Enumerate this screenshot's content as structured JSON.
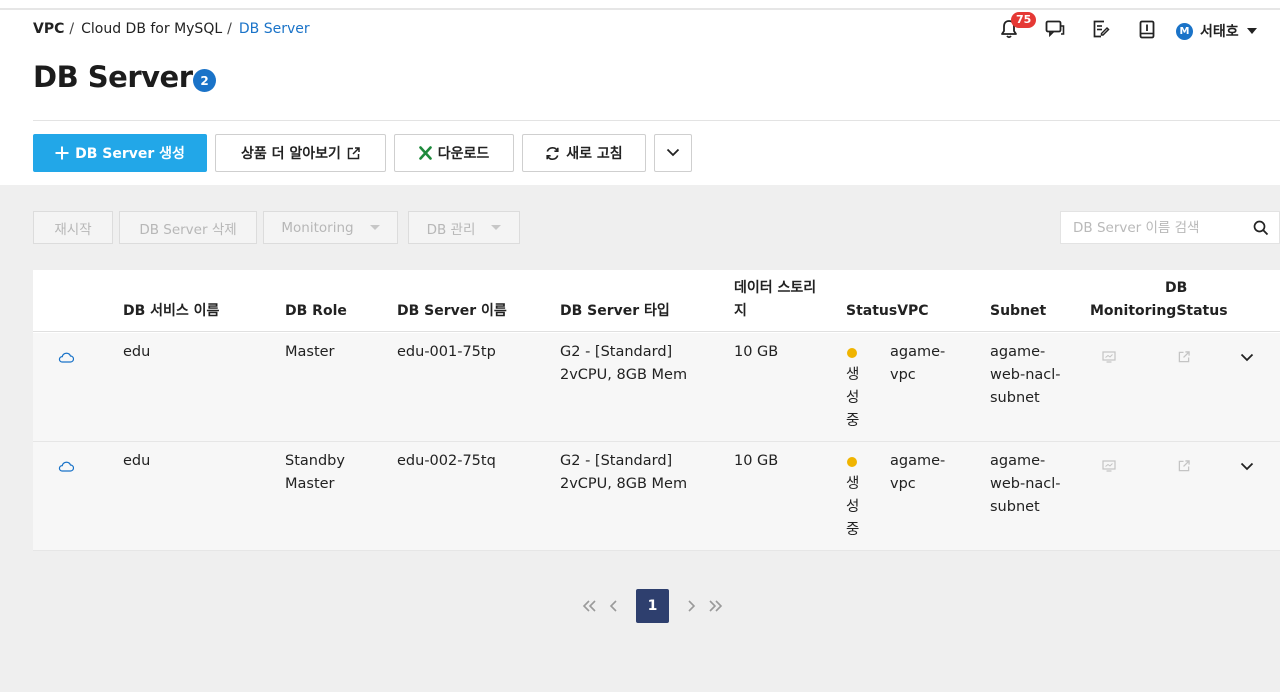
{
  "breadcrumb": {
    "items": [
      "VPC",
      "Cloud DB for MySQL",
      "DB Server"
    ],
    "separator": "/"
  },
  "header": {
    "notification_count": "75",
    "user_initial": "M",
    "user_name": "서태호"
  },
  "page": {
    "title": "DB Server",
    "count": "2"
  },
  "actions": {
    "create_label": "DB Server 생성",
    "learn_more_label": "상품 더 알아보기",
    "download_label": "다운로드",
    "refresh_label": "새로 고침"
  },
  "toolbar": {
    "restart_label": "재시작",
    "delete_label": "DB Server 삭제",
    "monitoring_label": "Monitoring",
    "db_manage_label": "DB 관리",
    "search_placeholder": "DB Server 이름 검색"
  },
  "table": {
    "columns": {
      "service_name": "DB 서비스 이름",
      "role": "DB Role",
      "server_name": "DB Server 이름",
      "server_type": "DB Server 타입",
      "storage_line1": "데이터 스토리",
      "storage_line2": "지",
      "status_vpc": "StatusVPC",
      "subnet": "Subnet",
      "db_line1": "DB",
      "monitoring_status": "MonitoringStatus"
    },
    "rows": [
      {
        "service_name": "edu",
        "role_line1": "Master",
        "role_line2": "",
        "server_name": "edu-001-75tp",
        "type_line1": "G2 - [Standard]",
        "type_line2": "2vCPU, 8GB Mem",
        "storage": "10 GB",
        "status": "생성중",
        "vpc_line1": "agame-",
        "vpc_line2": "vpc",
        "subnet_line1": "agame-",
        "subnet_line2": "web-nacl-",
        "subnet_line3": "subnet"
      },
      {
        "service_name": "edu",
        "role_line1": "Standby",
        "role_line2": "Master",
        "server_name": "edu-002-75tq",
        "type_line1": "G2 - [Standard]",
        "type_line2": "2vCPU, 8GB Mem",
        "storage": "10 GB",
        "status": "생성중",
        "vpc_line1": "agame-",
        "vpc_line2": "vpc",
        "subnet_line1": "agame-",
        "subnet_line2": "web-nacl-",
        "subnet_line3": "subnet"
      }
    ]
  },
  "pagination": {
    "current_page": "1"
  },
  "colors": {
    "primary": "#22a7e8",
    "link": "#1a73c8",
    "status_creating": "#f0b400",
    "page_active": "#2e3f6e",
    "badge_red": "#e53935"
  }
}
